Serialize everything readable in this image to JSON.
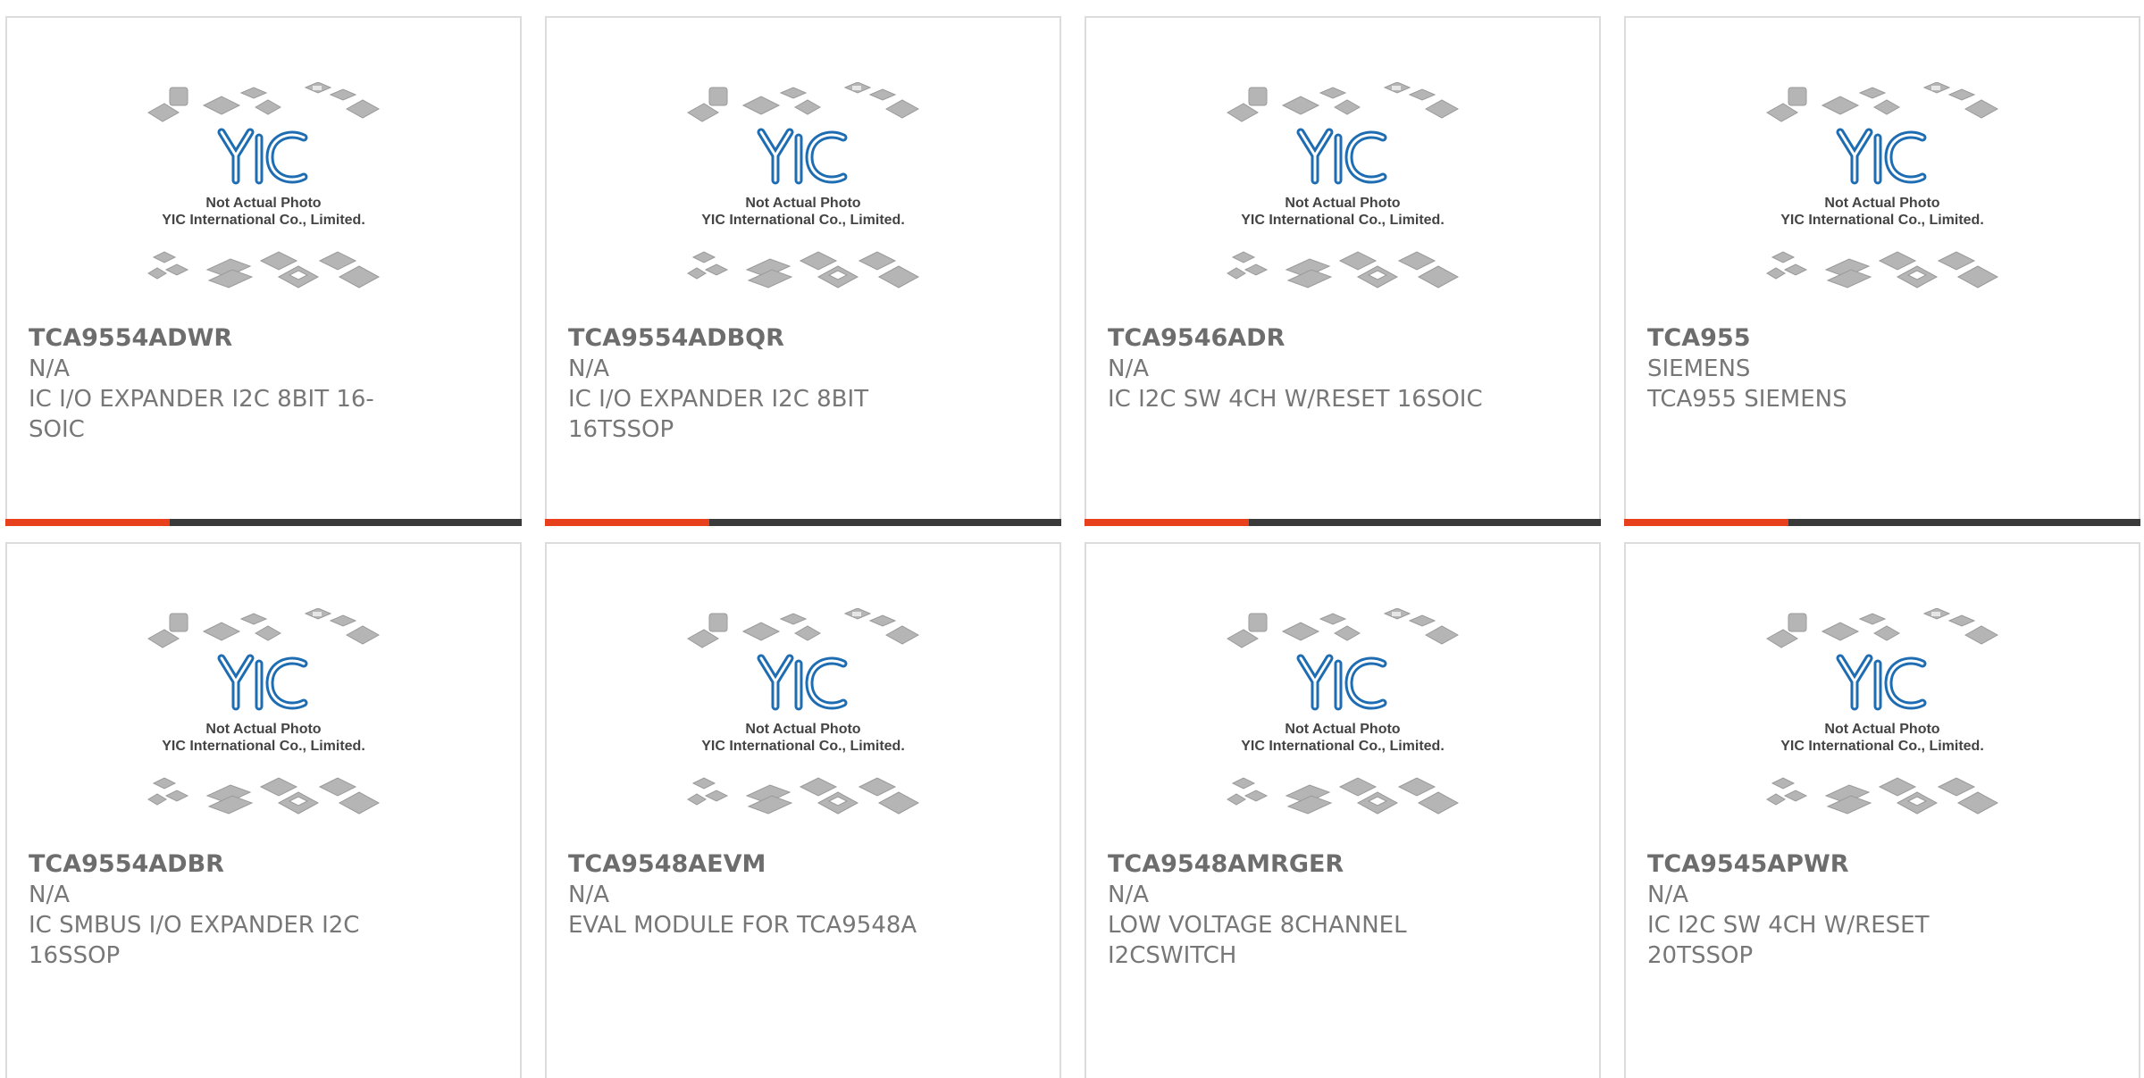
{
  "placeholder": {
    "line1": "Not Actual Photo",
    "line2": "YIC International Co., Limited.",
    "logo_text": "YIC"
  },
  "colors": {
    "accent": "#e8401c",
    "bar": "#3a3a3a",
    "logo_blue": "#2a7fc4",
    "text": "#777777",
    "border": "#dcdcdc"
  },
  "products": [
    {
      "part": "TCA9554ADWR",
      "brand": "N/A",
      "desc": "IC I/O EXPANDER I2C 8BIT 16-SOIC"
    },
    {
      "part": "TCA9554ADBQR",
      "brand": "N/A",
      "desc": "IC I/O EXPANDER I2C 8BIT 16TSSOP"
    },
    {
      "part": "TCA9546ADR",
      "brand": "N/A",
      "desc": "IC I2C SW 4CH W/RESET 16SOIC"
    },
    {
      "part": "TCA955",
      "brand": "SIEMENS",
      "desc": "TCA955 SIEMENS"
    },
    {
      "part": "TCA9554ADBR",
      "brand": "N/A",
      "desc": "IC SMBUS I/O EXPANDER I2C 16SSOP"
    },
    {
      "part": "TCA9548AEVM",
      "brand": "N/A",
      "desc": "EVAL MODULE FOR TCA9548A"
    },
    {
      "part": "TCA9548AMRGER",
      "brand": "N/A",
      "desc": "LOW VOLTAGE 8CHANNEL I2CSWITCH"
    },
    {
      "part": "TCA9545APWR",
      "brand": "N/A",
      "desc": "IC I2C SW 4CH W/RESET 20TSSOP"
    }
  ]
}
